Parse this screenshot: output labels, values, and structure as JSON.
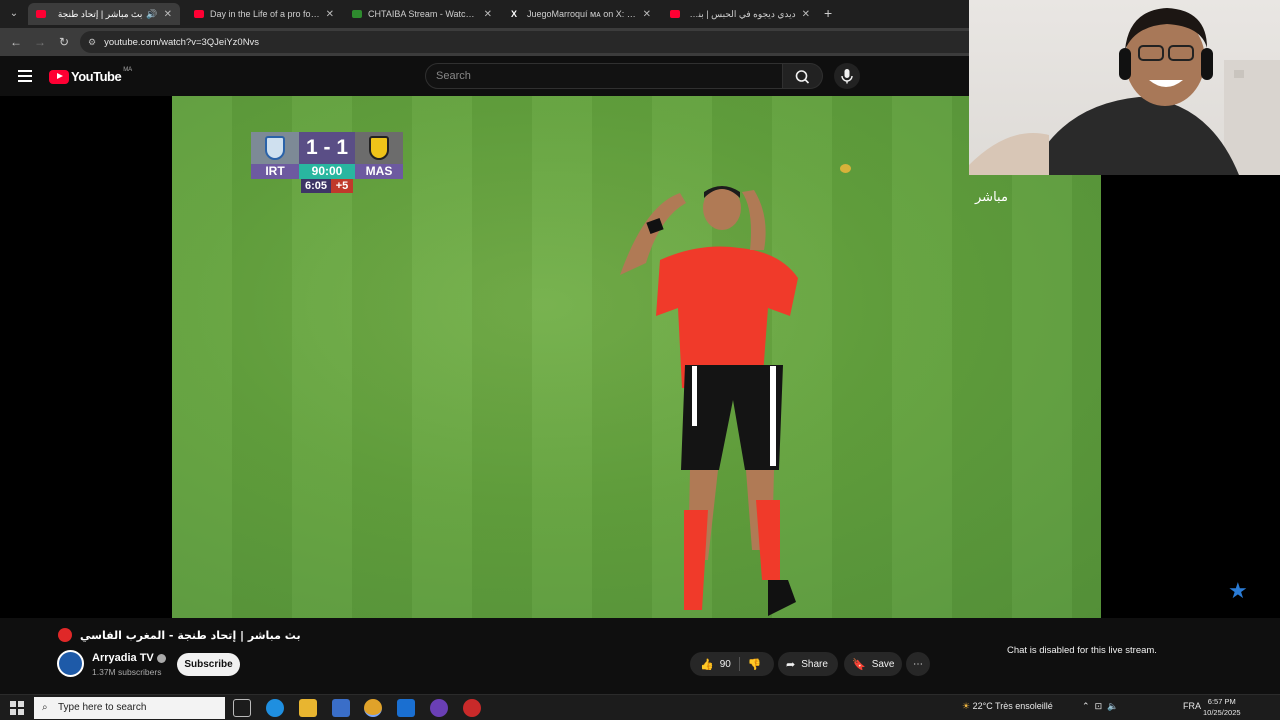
{
  "browser": {
    "tabs": [
      {
        "title": "بث مباشر | إتحاد طنجة",
        "active": true
      },
      {
        "title": "Day in the Life of a pro football",
        "active": false
      },
      {
        "title": "CHTAIBA Stream - Watch Live c",
        "active": false
      },
      {
        "title": "JuegoMarroquí ᴍᴀ on X: \"Azze",
        "active": false
      },
      {
        "title": "ديدي ديجوه في الحبس | بنت كانت",
        "active": false
      }
    ],
    "url": "youtube.com/watch?v=3QJeiYz0Nvs"
  },
  "youtube": {
    "logo_text": "YouTube",
    "country_code": "MA",
    "search_placeholder": "Search"
  },
  "scoreboard": {
    "home": "IRT",
    "away": "MAS",
    "score": "1 - 1",
    "match_time": "90:00",
    "added_clock": "6:05",
    "added_minutes": "+5"
  },
  "video": {
    "live_label": "مباشر",
    "title": "بث مباشر | إتحاد طنجة - المغرب الفاسي",
    "channel": "Arryadia TV",
    "subscribers": "1.37M subscribers",
    "subscribe_label": "Subscribe",
    "likes": "90",
    "share_label": "Share",
    "save_label": "Save",
    "chat_disabled": "Chat is disabled for this live stream."
  },
  "taskbar": {
    "search_placeholder": "Type here to search",
    "weather": "22°C  Très ensoleillé",
    "language": "FRA",
    "time": "6:57 PM",
    "date": "10/25/2025"
  },
  "colors": {
    "youtube_red": "#ff0033",
    "pitch_green": "#63a23d",
    "referee_shirt": "#f03a2a",
    "home_team": "#7d8a96",
    "away_team": "#f0c419"
  }
}
